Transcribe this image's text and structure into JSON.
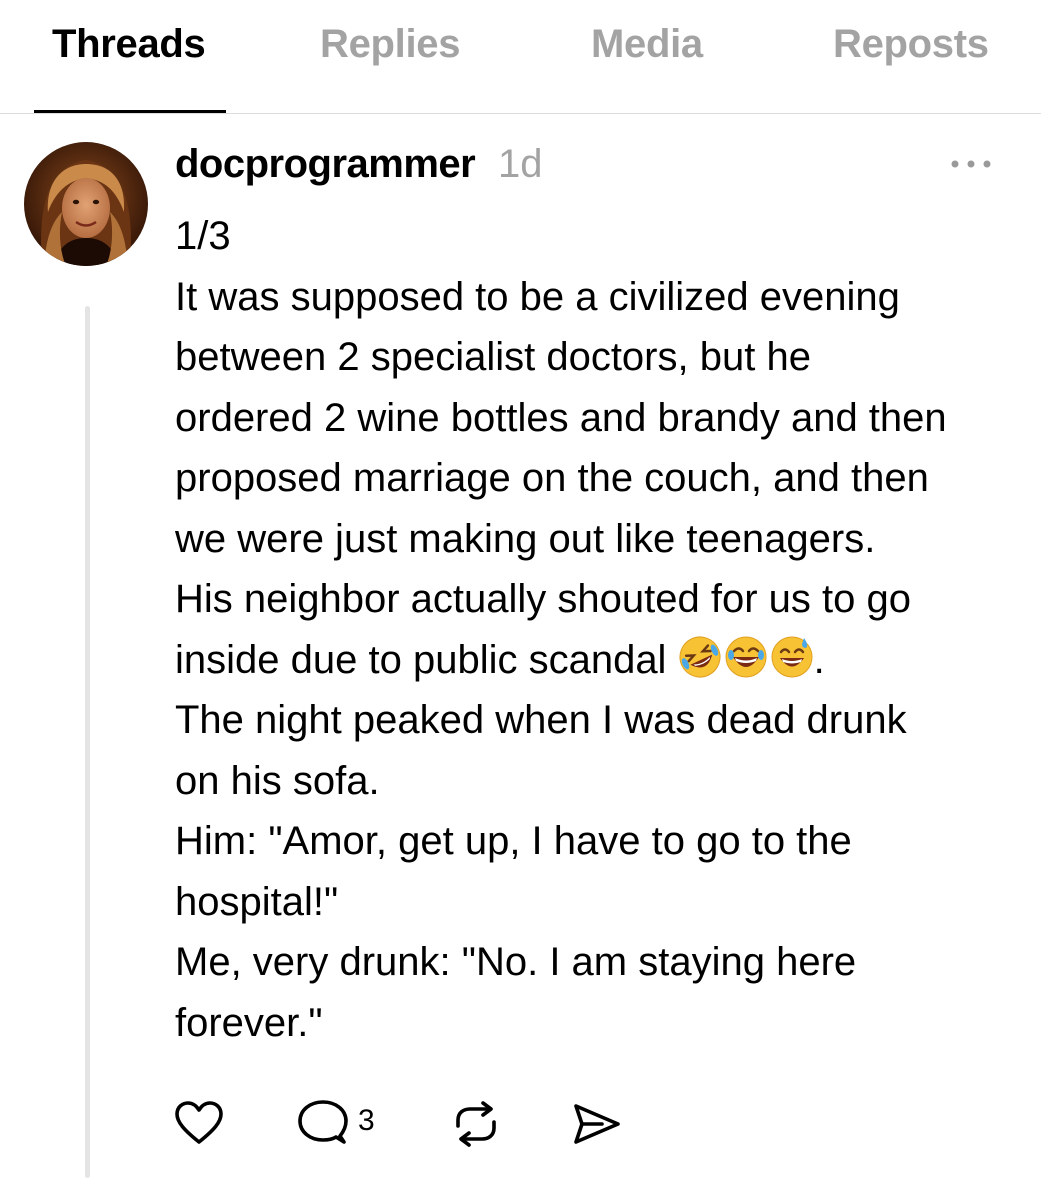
{
  "tabs": [
    {
      "label": "Threads",
      "active": true
    },
    {
      "label": "Replies",
      "active": false
    },
    {
      "label": "Media",
      "active": false
    },
    {
      "label": "Reposts",
      "active": false
    }
  ],
  "post": {
    "username": "docprogrammer",
    "time": "1d",
    "lines": [
      "1/3",
      "It was supposed to be a civilized evening",
      "between 2 specialist doctors, but he",
      "ordered 2 wine bottles and brandy and then",
      "proposed marriage on the couch, and then",
      "we were just making out like teenagers.",
      "His neighbor actually shouted for us to go",
      "inside due to public scandal",
      "The night peaked when I was dead drunk",
      "on his sofa.",
      "Him: \"Amor, get up, I have to go to the",
      "hospital!\"",
      "Me, very drunk: \"No. I am staying here",
      "forever.\""
    ],
    "emoji_suffix": ".",
    "emojis": [
      "rolling-on-floor-laughing-emoji",
      "grinning-squinting-emoji",
      "grinning-sweat-emoji"
    ],
    "reply_count": "3"
  },
  "icons": {
    "like": "heart-icon",
    "comment": "comment-icon",
    "repost": "repost-icon",
    "share": "share-icon",
    "more": "more-icon"
  }
}
